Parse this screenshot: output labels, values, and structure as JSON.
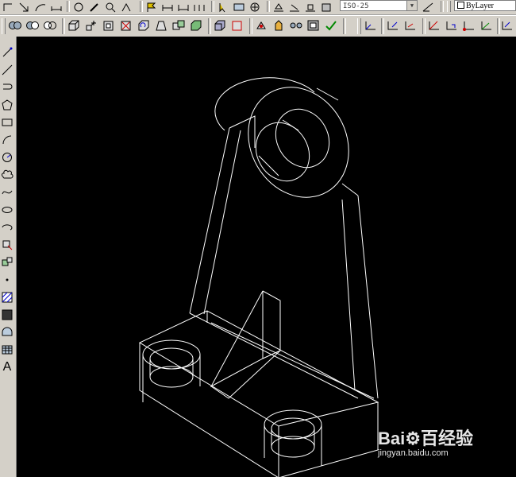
{
  "toolbar_top": {
    "dim_style_value": "ISO-25",
    "layer_value": "ByLayer"
  },
  "left_toolbar": {
    "text_tool_glyph": "A"
  },
  "watermark": {
    "logo_text": "Bai⚙百经验",
    "url": "jingyan.baidu.com"
  },
  "colors": {
    "toolbar_bg": "#d4d0c8",
    "canvas_bg": "#000000",
    "drawing_lines": "#ffffff"
  }
}
